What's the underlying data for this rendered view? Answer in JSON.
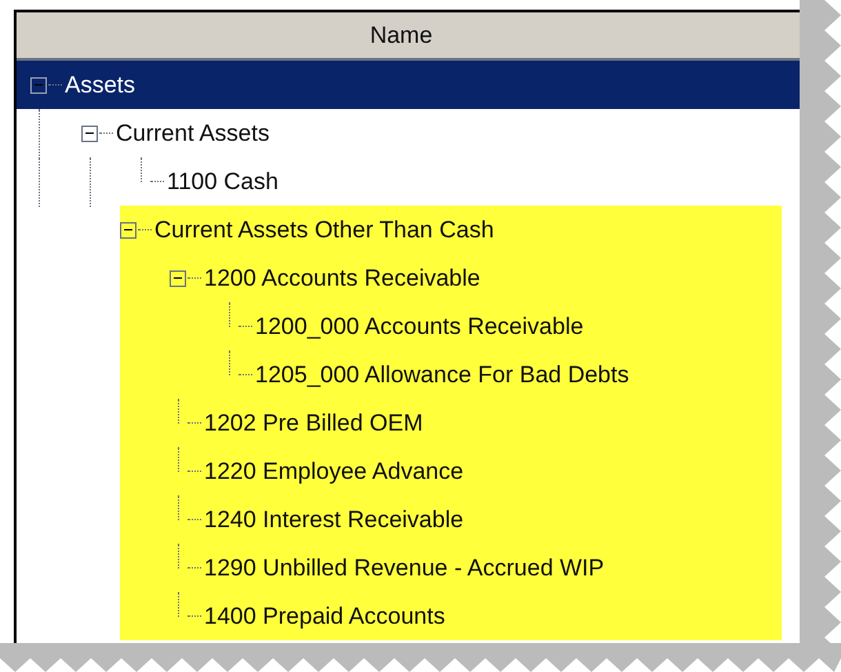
{
  "table": {
    "columns": [
      "Name"
    ]
  },
  "tree": [
    {
      "label": "Assets",
      "expanded": true,
      "selected": true,
      "highlighted": false,
      "children": [
        {
          "label": "Current Assets",
          "expanded": true,
          "selected": false,
          "highlighted": false,
          "children": [
            {
              "label": "1100 Cash",
              "selected": false,
              "highlighted": false
            },
            {
              "label": "Current Assets Other Than Cash",
              "expanded": true,
              "selected": false,
              "highlighted": true,
              "children": [
                {
                  "label": "1200 Accounts Receivable",
                  "expanded": true,
                  "selected": false,
                  "highlighted": true,
                  "children": [
                    {
                      "label": "1200_000 Accounts Receivable",
                      "selected": false,
                      "highlighted": true
                    },
                    {
                      "label": "1205_000 Allowance For Bad Debts",
                      "selected": false,
                      "highlighted": true
                    }
                  ]
                },
                {
                  "label": "1202 Pre Billed OEM",
                  "selected": false,
                  "highlighted": true
                },
                {
                  "label": "1220 Employee Advance",
                  "selected": false,
                  "highlighted": true
                },
                {
                  "label": "1240 Interest Receivable",
                  "selected": false,
                  "highlighted": true
                },
                {
                  "label": "1290 Unbilled Revenue - Accrued WIP",
                  "selected": false,
                  "highlighted": true
                },
                {
                  "label": "1400 Prepaid Accounts",
                  "selected": false,
                  "highlighted": true
                }
              ]
            }
          ]
        }
      ]
    }
  ]
}
